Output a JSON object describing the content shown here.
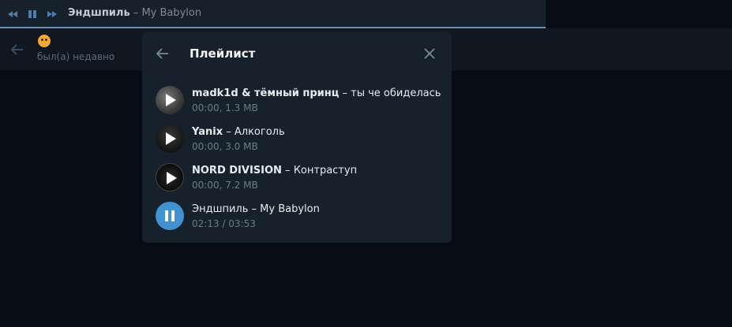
{
  "player": {
    "artist": "Эндшпиль",
    "separator": " – ",
    "title": "My Babylon"
  },
  "chat": {
    "status": "был(а) недавно"
  },
  "playlist": {
    "title": "Плейлист",
    "tracks": [
      {
        "artist": "madk1d & тёмный принц",
        "sep": " – ",
        "title": "ты че обиделась",
        "info": "00:00, 1.3 MB",
        "state": "paused"
      },
      {
        "artist": "Yanix",
        "sep": " – ",
        "title": "Алкоголь",
        "info": "00:00, 3.0 MB",
        "state": "paused"
      },
      {
        "artist": "NORD DIVISION",
        "sep": " – ",
        "title": "Контраступ",
        "info": "00:00, 7.2 MB",
        "state": "paused"
      },
      {
        "artist": "Эндшпиль",
        "sep": " – ",
        "title": "My Babylon",
        "info": "02:13 / 03:53",
        "state": "playing"
      }
    ]
  },
  "colors": {
    "accent": "#4291d0",
    "background": "#080d15",
    "panel": "#17212b"
  },
  "icons": {
    "prev": "previous-track-icon",
    "pause": "pause-icon",
    "next": "next-track-icon",
    "back": "arrow-left-icon",
    "close": "close-icon",
    "play": "play-icon",
    "emoji": "emoji-status-icon"
  }
}
